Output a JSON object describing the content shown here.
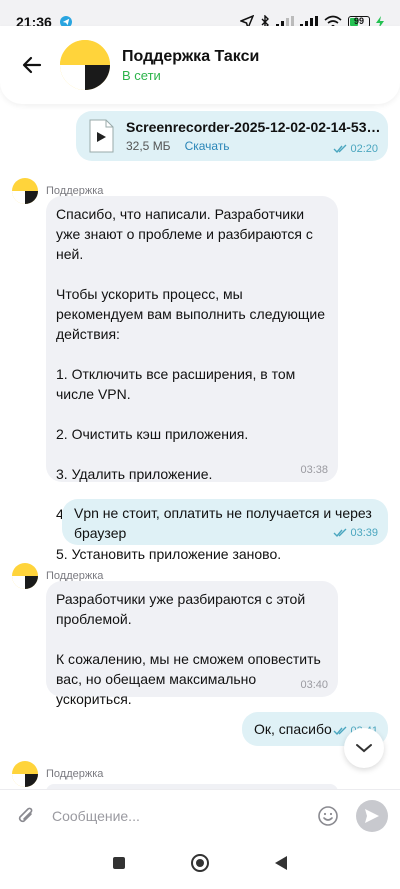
{
  "status": {
    "time": "21:36",
    "battery": "99"
  },
  "header": {
    "title": "Поддержка Такси",
    "subtitle": "В сети"
  },
  "file_message": {
    "name": "Screenrecorder-2025-12-02-02-14-53-36....",
    "size": "32,5 МБ",
    "download_label": "Скачать",
    "time": "02:20"
  },
  "messages": [
    {
      "sender": "Поддержка",
      "text": "Спасибо, что написали. Разработчики уже знают о проблеме и разбираются с ней.\n\nЧтобы ускорить процесс, мы рекомендуем вам выполнить следующие действия:\n\n1. Отключить все расширения, в том числе VPN.\n\n2. Очистить кэш приложения.\n\n3. Удалить приложение.\n\n4. Перезагрузить устройство.\n\n5. Установить приложение заново.",
      "time": "03:38"
    },
    {
      "text": "Vpn не стоит, оплатить не получается и через браузер",
      "time": "03:39"
    },
    {
      "sender": "Поддержка",
      "text": "Разработчики уже разбираются с этой проблемой.\n\nК сожалению, мы не сможем оповестить вас, но обещаем максимально ускориться.",
      "time": "03:40"
    },
    {
      "text": "Ок, спасибо",
      "time": "03:41"
    },
    {
      "sender": "Поддержка"
    }
  ],
  "composer": {
    "placeholder": "Сообщение..."
  },
  "colors": {
    "online": "#2cb34a",
    "outgoing_bubble": "#dff1f6",
    "incoming_bubble": "#f0f1f5",
    "brand_yellow": "#ffd43b"
  }
}
